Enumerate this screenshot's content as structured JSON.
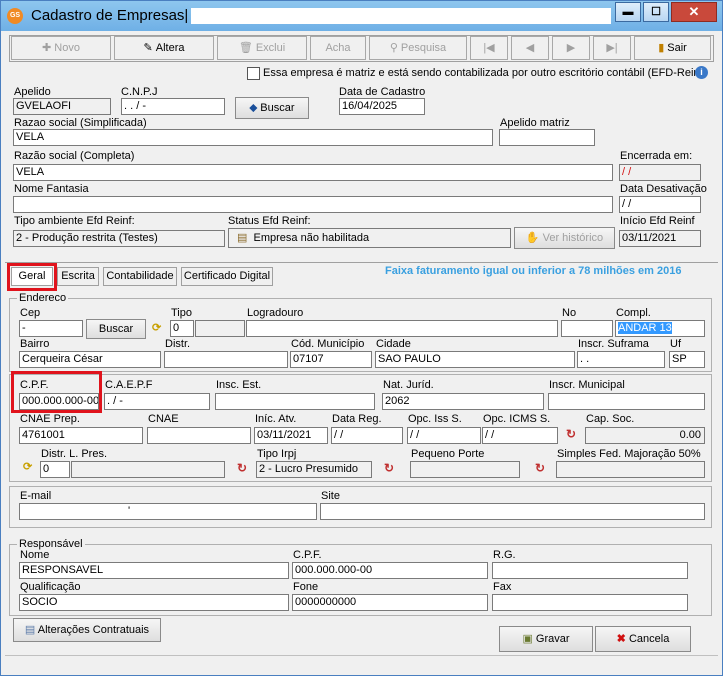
{
  "window": {
    "title": "Cadastro de Empresas|",
    "app_icon": "GS",
    "min": "▬",
    "max": "☐",
    "close": "✕"
  },
  "toolbar": {
    "novo": "Novo",
    "altera": "Altera",
    "exclui": "Exclui",
    "acha": "Acha",
    "pesquisa": "Pesquisa",
    "first": "|◀",
    "prev": "◀",
    "next": "▶",
    "last": "▶|",
    "sair": "Sair"
  },
  "matriz_check": "Essa empresa é matriz e está sendo contabilizada por outro escritório contábil (EFD-Reinf",
  "fields": {
    "apelido_label": "Apelido",
    "apelido": "GVELAOFI",
    "cnpj_label": "C.N.P.J",
    "cnpj": " .   .   /    -",
    "buscar": "Buscar",
    "data_cadastro_label": "Data de Cadastro",
    "data_cadastro": "16/04/2025",
    "razao_simpl_label": "Razao social (Simplificada)",
    "razao_simpl": "VELA",
    "apelido_matriz_label": "Apelido matriz",
    "apelido_matriz": "",
    "razao_completa_label": "Razão social (Completa)",
    "razao_completa": "VELA",
    "encerrada_label": "Encerrada em:",
    "encerrada": " /  /",
    "fantasia_label": "Nome Fantasia",
    "fantasia": "",
    "desativacao_label": "Data Desativação",
    "desativacao": " /  /",
    "tipo_ambiente_label": "Tipo ambiente Efd Reinf:",
    "tipo_ambiente": "2 - Produção restrita (Testes)",
    "status_label": "Status Efd Reinf:",
    "status": "Empresa não habilitada",
    "ver_historico": "Ver histórico",
    "inicio_label": "Início Efd Reinf",
    "inicio": "03/11/2021"
  },
  "tabs": [
    "Geral",
    "Escrita",
    "Contabilidade",
    "Certificado Digital"
  ],
  "faixa": "Faixa faturamento igual ou inferior a 78 milhões em 2016",
  "endereco": {
    "group": "Endereco",
    "cep_label": "Cep",
    "cep": "    -",
    "buscar": "Buscar",
    "tipo_label": "Tipo",
    "tipo": "0",
    "logradouro_label": "Logradouro",
    "logradouro": "",
    "no_label": "No",
    "no": "",
    "compl_label": "Compl.",
    "compl": "ANDAR 13",
    "bairro_label": "Bairro",
    "bairro": "Cerqueira César",
    "distr_label": "Distr.",
    "distr": "",
    "cod_mun_label": "Cód. Município",
    "cod_mun": "07107",
    "cidade_label": "Cidade",
    "cidade": "SAO PAULO",
    "suframa_label": "Inscr. Suframa",
    "suframa": "   .   .",
    "uf_label": "Uf",
    "uf": "SP"
  },
  "fiscal": {
    "cpf_label": "C.P.F.",
    "cpf": "000.000.000-00",
    "caepf_label": "C.A.E.P.F",
    "caepf": "   .   /   -",
    "insc_est_label": "Insc. Est.",
    "insc_est": "",
    "nat_jur_label": "Nat. Juríd.",
    "nat_jur": "2062",
    "insc_mun_label": "Inscr. Municipal",
    "insc_mun": "",
    "cnae_prep_label": "CNAE Prep.",
    "cnae_prep": "4761001",
    "cnae_label": "CNAE",
    "cnae": "",
    "inic_atv_label": "Iníc. Atv.",
    "inic_atv": "03/11/2021",
    "data_reg_label": "Data Reg.",
    "data_reg": " /  /",
    "opc_iss_label": "Opc. Iss S.",
    "opc_iss": " /  /",
    "opc_icms_label": "Opc. ICMS S.",
    "opc_icms": " /  /",
    "cap_soc_label": "Cap. Soc.",
    "cap_soc": "0.00",
    "distr_pres_label": "Distr. L. Pres.",
    "distr_pres": "0",
    "tipo_irpj_label": "Tipo Irpj",
    "tipo_irpj": "2 - Lucro Presumido",
    "peq_porte_label": "Pequeno Porte",
    "peq_porte": "",
    "simples_label": "Simples Fed. Majoração 50%",
    "simples": ""
  },
  "contato": {
    "email_label": "E-mail",
    "email": "'",
    "site_label": "Site",
    "site": ""
  },
  "responsavel": {
    "group": "Responsável",
    "nome_label": "Nome",
    "nome": "RESPONSAVEL",
    "cpf_label": "C.P.F.",
    "cpf": "000.000.000-00",
    "rg_label": "R.G.",
    "rg": "",
    "qual_label": "Qualificação",
    "qual": "SOCIO",
    "fone_label": "Fone",
    "fone": "0000000000",
    "fax_label": "Fax",
    "fax": ""
  },
  "footer": {
    "alteracoes": "Alterações Contratuais",
    "gravar": "Gravar",
    "cancela": "Cancela"
  },
  "colors": {
    "highlight_red": "#e0131c",
    "faixa_blue": "#3aa0e0",
    "title_bg": "#8ec6ee"
  }
}
